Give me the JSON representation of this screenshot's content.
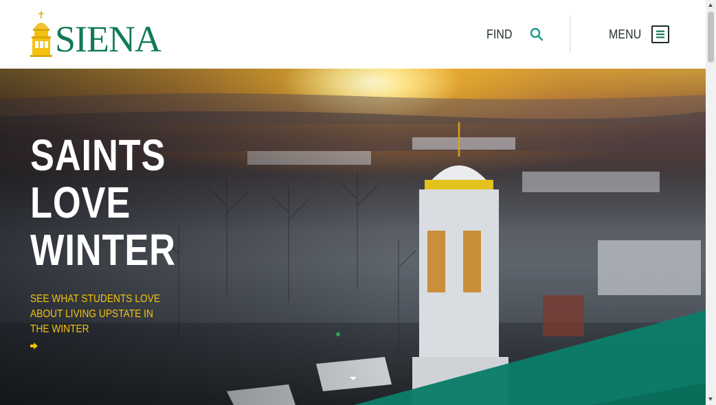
{
  "header": {
    "logo_text": "SIENA",
    "find_label": "FIND",
    "menu_label": "MENU"
  },
  "hero": {
    "headline": [
      "SAINTS",
      "LOVE",
      "WINTER"
    ],
    "subcopy": "SEE WHAT STUDENTS LOVE ABOUT LIVING UPSTATE IN THE WINTER",
    "active_slide": 1
  },
  "icons": {
    "find": "search-icon",
    "menu": "hamburger-menu-icon",
    "cta": "arrow-right-icon",
    "scroll": "caret-down-icon",
    "logo": "dome-logo-icon"
  },
  "colors": {
    "brand_green": "#0f7a5a",
    "brand_gold": "#f4c20d",
    "teal_band": "#0b7d68",
    "header_text": "#1e2b2b",
    "search_icon": "#1a9a8a"
  }
}
